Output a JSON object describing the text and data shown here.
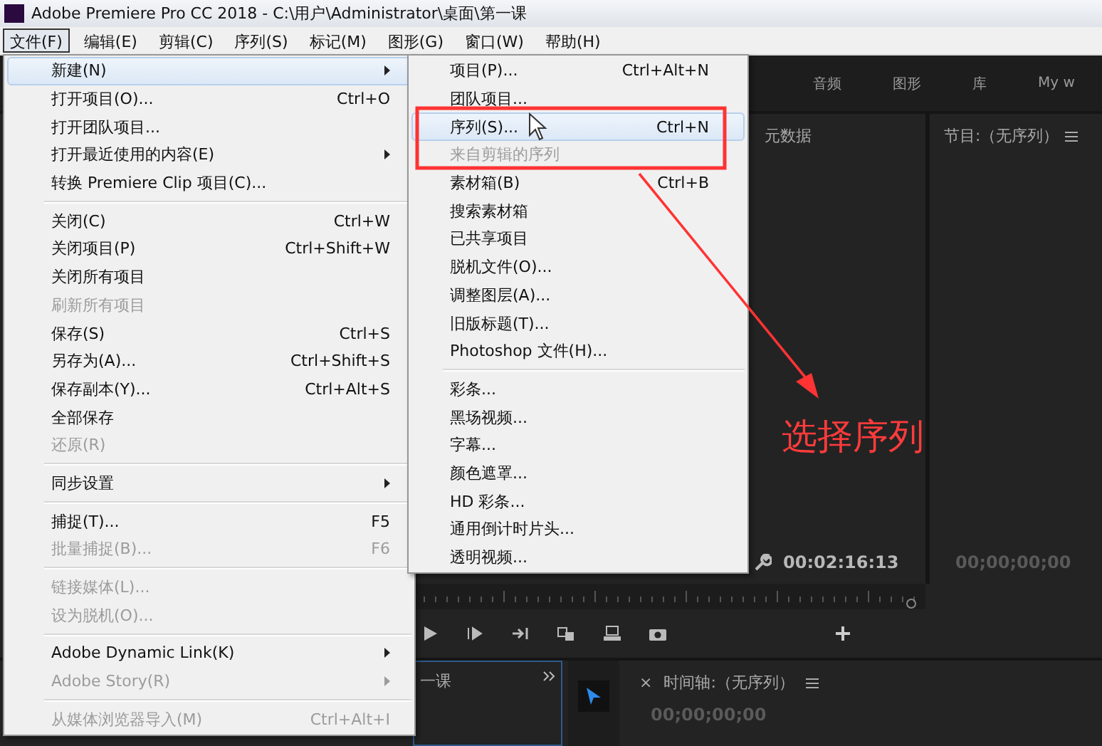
{
  "window": {
    "title": "Adobe Premiere Pro CC 2018 - C:\\用户\\Administrator\\桌面\\第一课"
  },
  "menubar": [
    {
      "label": "文件(F)",
      "selected": true
    },
    {
      "label": "编辑(E)",
      "selected": false
    },
    {
      "label": "剪辑(C)",
      "selected": false
    },
    {
      "label": "序列(S)",
      "selected": false
    },
    {
      "label": "标记(M)",
      "selected": false
    },
    {
      "label": "图形(G)",
      "selected": false
    },
    {
      "label": "窗口(W)",
      "selected": false
    },
    {
      "label": "帮助(H)",
      "selected": false
    }
  ],
  "file_menu": [
    [
      {
        "label": "新建(N)",
        "has_submenu": true,
        "disabled": false,
        "selected": true
      },
      {
        "label": "打开项目(O)...",
        "shortcut": "Ctrl+O",
        "has_submenu": false,
        "disabled": false,
        "selected": false
      },
      {
        "label": "打开团队项目...",
        "has_submenu": false,
        "disabled": false,
        "selected": false
      },
      {
        "label": "打开最近使用的内容(E)",
        "has_submenu": true,
        "disabled": false,
        "selected": false
      },
      {
        "label": "转换 Premiere Clip 项目(C)...",
        "has_submenu": false,
        "disabled": false,
        "selected": false
      }
    ],
    [
      {
        "label": "关闭(C)",
        "shortcut": "Ctrl+W",
        "has_submenu": false,
        "disabled": false,
        "selected": false
      },
      {
        "label": "关闭项目(P)",
        "shortcut": "Ctrl+Shift+W",
        "has_submenu": false,
        "disabled": false,
        "selected": false
      },
      {
        "label": "关闭所有项目",
        "has_submenu": false,
        "disabled": false,
        "selected": false
      },
      {
        "label": "刷新所有项目",
        "has_submenu": false,
        "disabled": true,
        "selected": false
      },
      {
        "label": "保存(S)",
        "shortcut": "Ctrl+S",
        "has_submenu": false,
        "disabled": false,
        "selected": false
      },
      {
        "label": "另存为(A)...",
        "shortcut": "Ctrl+Shift+S",
        "has_submenu": false,
        "disabled": false,
        "selected": false
      },
      {
        "label": "保存副本(Y)...",
        "shortcut": "Ctrl+Alt+S",
        "has_submenu": false,
        "disabled": false,
        "selected": false
      },
      {
        "label": "全部保存",
        "has_submenu": false,
        "disabled": false,
        "selected": false
      },
      {
        "label": "还原(R)",
        "has_submenu": false,
        "disabled": true,
        "selected": false
      }
    ],
    [
      {
        "label": "同步设置",
        "has_submenu": true,
        "disabled": false,
        "selected": false
      }
    ],
    [
      {
        "label": "捕捉(T)...",
        "shortcut": "F5",
        "has_submenu": false,
        "disabled": false,
        "selected": false
      },
      {
        "label": "批量捕捉(B)...",
        "shortcut": "F6",
        "has_submenu": false,
        "disabled": true,
        "selected": false
      }
    ],
    [
      {
        "label": "链接媒体(L)...",
        "has_submenu": false,
        "disabled": true,
        "selected": false
      },
      {
        "label": "设为脱机(O)...",
        "has_submenu": false,
        "disabled": true,
        "selected": false
      }
    ],
    [
      {
        "label": "Adobe Dynamic Link(K)",
        "has_submenu": true,
        "disabled": false,
        "selected": false
      },
      {
        "label": "Adobe Story(R)",
        "has_submenu": true,
        "disabled": true,
        "selected": false
      }
    ],
    [
      {
        "label": "从媒体浏览器导入(M)",
        "shortcut": "Ctrl+Alt+I",
        "has_submenu": false,
        "disabled": true,
        "selected": false
      }
    ]
  ],
  "new_submenu": [
    [
      {
        "label": "项目(P)...",
        "shortcut": "Ctrl+Alt+N",
        "disabled": false,
        "selected": false
      },
      {
        "label": "团队项目...",
        "disabled": false,
        "selected": false
      },
      {
        "label": "序列(S)...",
        "shortcut": "Ctrl+N",
        "disabled": false,
        "selected": true
      },
      {
        "label": "来自剪辑的序列",
        "disabled": true,
        "selected": false
      },
      {
        "label": "素材箱(B)",
        "shortcut": "Ctrl+B",
        "disabled": false,
        "selected": false
      },
      {
        "label": "搜索素材箱",
        "disabled": false,
        "selected": false
      },
      {
        "label": "已共享项目",
        "disabled": false,
        "selected": false
      },
      {
        "label": "脱机文件(O)...",
        "disabled": false,
        "selected": false
      },
      {
        "label": "调整图层(A)...",
        "disabled": false,
        "selected": false
      },
      {
        "label": "旧版标题(T)...",
        "disabled": false,
        "selected": false
      },
      {
        "label": "Photoshop 文件(H)...",
        "disabled": false,
        "selected": false
      }
    ],
    [
      {
        "label": "彩条...",
        "disabled": false,
        "selected": false
      },
      {
        "label": "黑场视频...",
        "disabled": false,
        "selected": false
      },
      {
        "label": "字幕...",
        "disabled": false,
        "selected": false
      },
      {
        "label": "颜色遮罩...",
        "disabled": false,
        "selected": false
      },
      {
        "label": "HD 彩条...",
        "disabled": false,
        "selected": false
      },
      {
        "label": "通用倒计时片头...",
        "disabled": false,
        "selected": false
      },
      {
        "label": "透明视频...",
        "disabled": false,
        "selected": false
      }
    ]
  ],
  "workspace_tabs": [
    "音频",
    "图形",
    "库",
    "My w"
  ],
  "source_panel": {
    "title": "元数据",
    "timecode": "00:02:16:13"
  },
  "program_panel": {
    "title": "节目:（无序列）",
    "timecode": "00;00;00;00"
  },
  "project_panel": {
    "tab": "一课"
  },
  "timeline_panel": {
    "close": "×",
    "title": "时间轴:（无序列）",
    "timecode": "00;00;00;00"
  },
  "annotation": {
    "text": "选择序列"
  }
}
